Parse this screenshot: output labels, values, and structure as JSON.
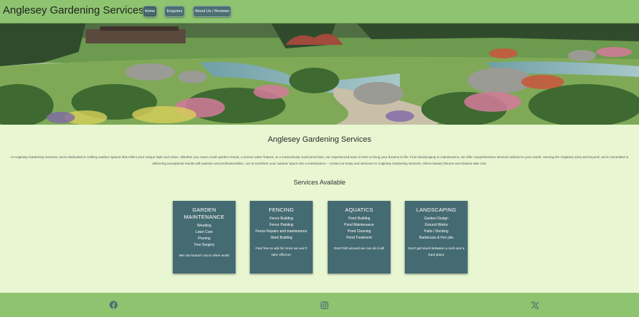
{
  "header": {
    "brand": "Anglesey Gardening Services",
    "nav": [
      {
        "label": "Home"
      },
      {
        "label": "Enquires"
      },
      {
        "label": "About Us / Reviews"
      }
    ]
  },
  "main": {
    "title": "Anglesey Gardening Services",
    "intro": "At Anglesey Gardening Services, we're dedicated to crafting outdoor spaces that reflect your unique style and vision. Whether you crave a lush garden retreat, a serene water feature, or a meticulously manicured lawn, our experienced team is here to bring your dreams to life. From landscaping to maintenance, we offer comprehensive services tailored to your needs. Serving the Anglesey area and beyond, we're committed to delivering exceptional results with passion and professionalism. Let us transform your outdoor space into a masterpiece – contact us today and welcome to Anglesey Gardening Services, where beauty blooms and dreams take root.",
    "services_heading": "Services Available",
    "services": [
      {
        "title": "GARDEN MAINTENANCE",
        "items": [
          "Weeding",
          "Lawn Care",
          "Pruning",
          "Tree Surgery"
        ],
        "note": "We can branch out to other work!"
      },
      {
        "title": "FENCING",
        "items": [
          "Fence Building",
          "Fence Painting",
          "Fence Repairs and maintenance",
          "Shed Building"
        ],
        "note": "Feel free to ask for more we won't take offence!"
      },
      {
        "title": "AQUATICS",
        "items": [
          "Pond Building",
          "Pond Maintenance",
          "Pond Cleaning",
          "Pond Treatment"
        ],
        "note": "Don't fish around we can do it all!"
      },
      {
        "title": "LANDSCAPING",
        "items": [
          "Garden Design",
          "Ground Works",
          "Patio / Decking",
          "Barbecues & Fire pits"
        ],
        "note": "Don't get stuck between a rock and a hard place"
      }
    ]
  },
  "footer": {
    "icons": [
      "facebook-icon",
      "instagram-icon",
      "x-twitter-icon"
    ]
  },
  "colors": {
    "nav_bg": "#8ec470",
    "page_bg": "#e8f6d2",
    "card_bg": "#456b72",
    "nav_button": "#4d6f73"
  }
}
